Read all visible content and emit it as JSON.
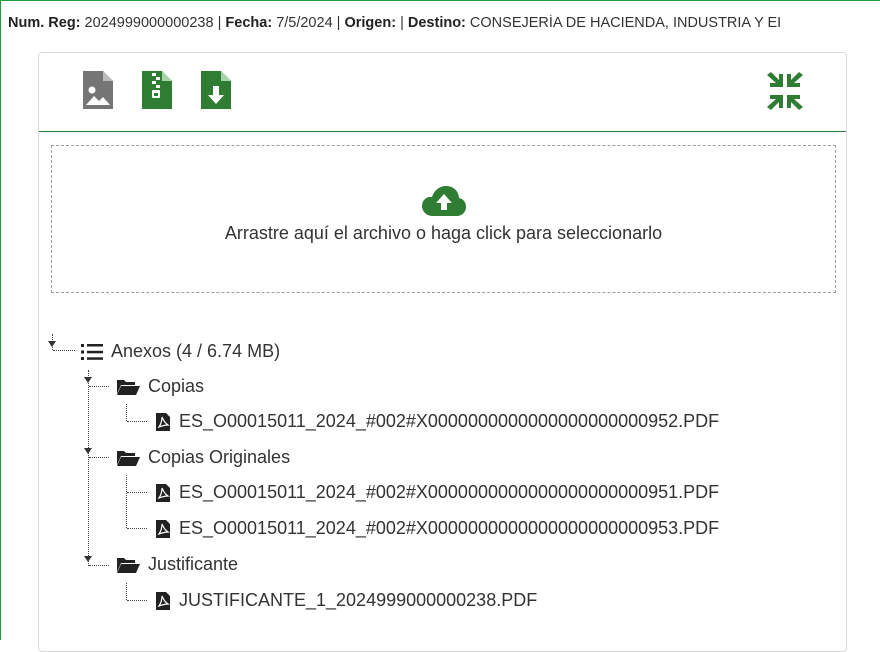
{
  "header": {
    "num_reg_label": "Num. Reg:",
    "num_reg_value": "2024999000000238",
    "fecha_label": "Fecha:",
    "fecha_value": "7/5/2024",
    "origen_label": "Origen:",
    "origen_value": "",
    "destino_label": "Destino:",
    "destino_value": "CONSEJERÍA DE HACIENDA, INDUSTRIA Y EI",
    "separator": "|"
  },
  "toolbar": {
    "buttons": [
      {
        "icon": "image-file-icon",
        "color": "#757575"
      },
      {
        "icon": "zip-file-icon",
        "color": "#2e7d32"
      },
      {
        "icon": "download-file-icon",
        "color": "#2e7d32"
      },
      {
        "icon": "compress-icon",
        "color": "#2e7d32"
      }
    ]
  },
  "dropzone": {
    "text": "Arrastre aquí el archivo o haga click para seleccionarlo",
    "icon": "cloud-upload-icon"
  },
  "tree": {
    "root": {
      "label": "Anexos (4 / 6.74 MB)",
      "icon": "list-icon"
    },
    "folders": [
      {
        "label": "Copias",
        "icon": "folder-open-icon",
        "files": [
          "ES_O00015011_2024_#002#X0000000000000000000000952.PDF"
        ]
      },
      {
        "label": "Copias Originales",
        "icon": "folder-open-icon",
        "files": [
          "ES_O00015011_2024_#002#X0000000000000000000000951.PDF",
          "ES_O00015011_2024_#002#X0000000000000000000000953.PDF"
        ]
      },
      {
        "label": "Justificante",
        "icon": "folder-open-icon",
        "files": [
          "JUSTIFICANTE_1_2024999000000238.PDF"
        ]
      }
    ]
  },
  "colors": {
    "accent": "#2e7d32",
    "border": "#1f9d3a",
    "muted": "#757575"
  }
}
